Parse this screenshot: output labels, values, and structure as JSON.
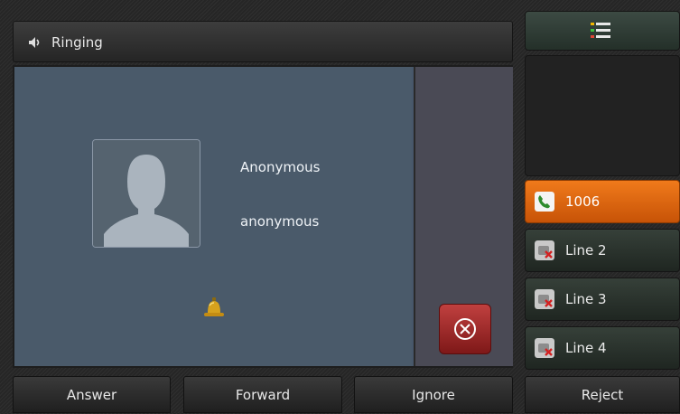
{
  "header": {
    "title": "Ringing",
    "icon": "speaker-icon"
  },
  "call": {
    "contact_name": "Anonymous",
    "contact_number": "anonymous",
    "avatar_icon": "person-silhouette-icon",
    "status_icon": "bell-icon",
    "end_icon": "x-circle-icon"
  },
  "lines": [
    {
      "label": "1006",
      "icon": "phone-handset-icon",
      "active": true
    },
    {
      "label": "Line 2",
      "icon": "phone-unregistered-icon",
      "active": false
    },
    {
      "label": "Line 3",
      "icon": "phone-unregistered-icon",
      "active": false
    },
    {
      "label": "Line 4",
      "icon": "phone-unregistered-icon",
      "active": false
    }
  ],
  "softkeys": [
    "Answer",
    "Forward",
    "Ignore",
    "Reject"
  ],
  "colors": {
    "active_line": "#e56a10",
    "end_button": "#9b2323",
    "menu_dots": [
      "#f2b600",
      "#42c140",
      "#e14536"
    ]
  }
}
